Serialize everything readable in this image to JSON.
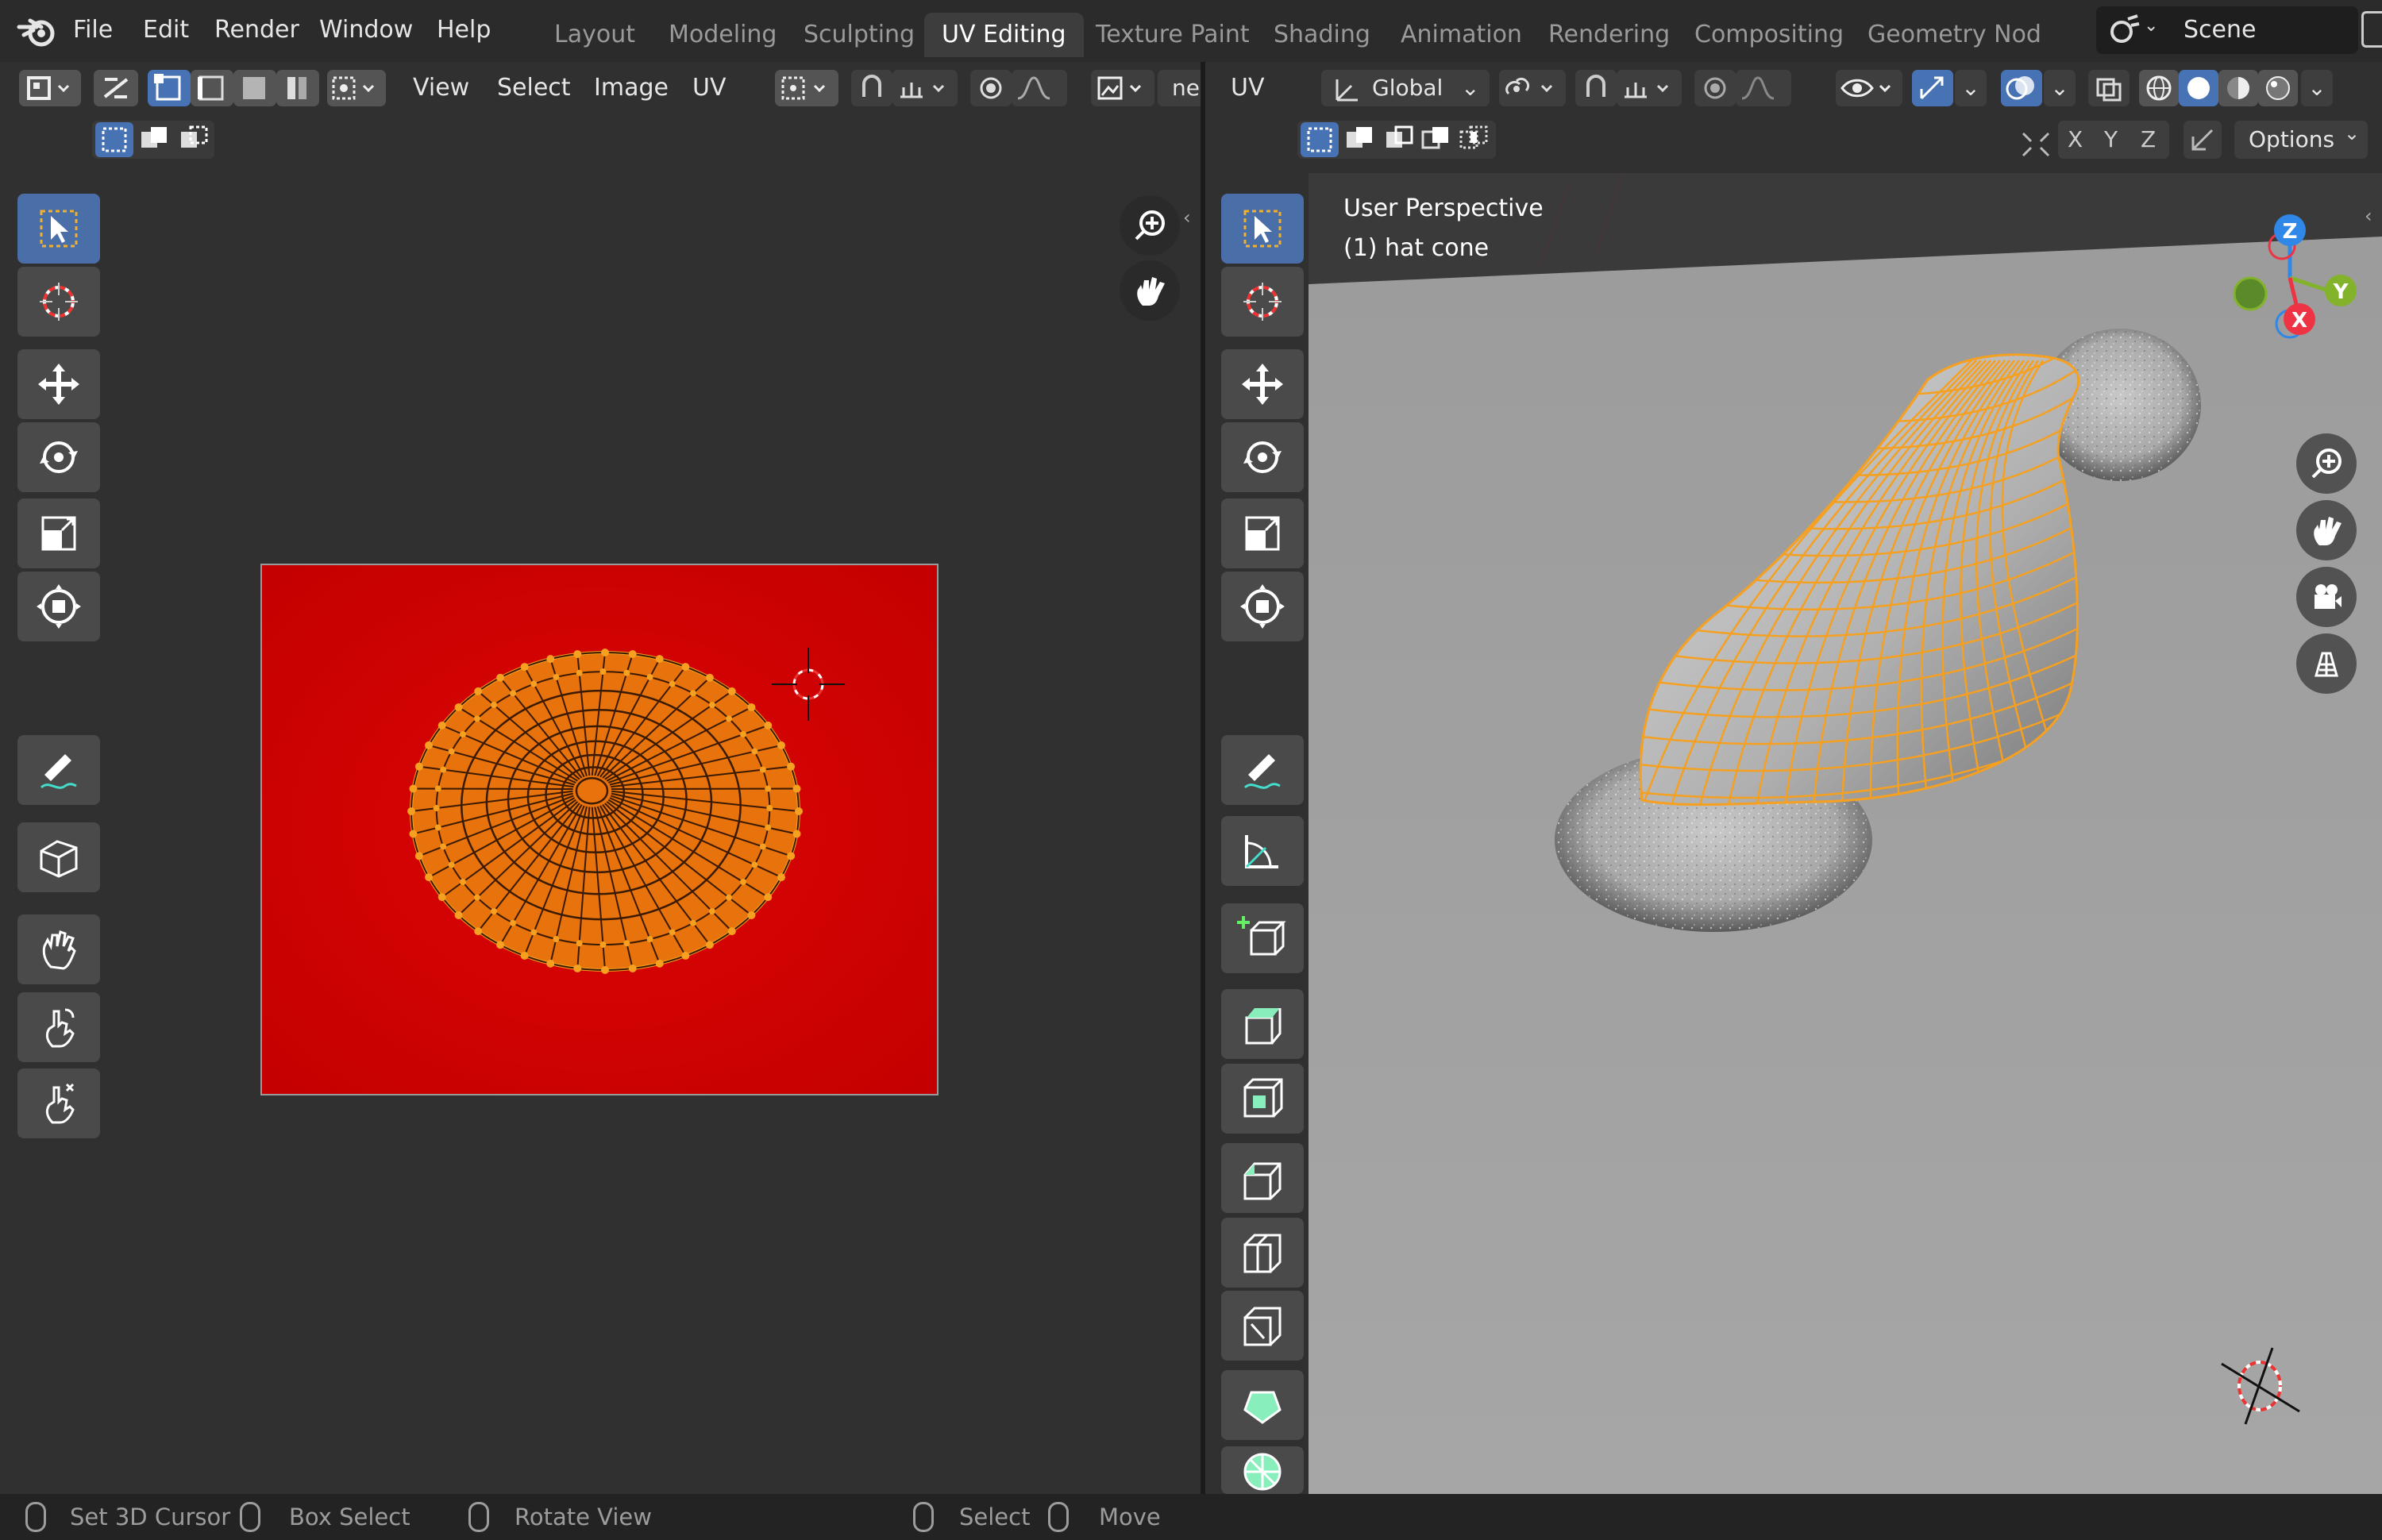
{
  "menu": [
    "File",
    "Edit",
    "Render",
    "Window",
    "Help"
  ],
  "workspaces": [
    "Layout",
    "Modeling",
    "Sculpting",
    "UV Editing",
    "Texture Paint",
    "Shading",
    "Animation",
    "Rendering",
    "Compositing",
    "Geometry Nod"
  ],
  "active_workspace": "UV Editing",
  "scene": "Scene",
  "uv_editor": {
    "header_menus": [
      "View",
      "Select",
      "Image",
      "UV"
    ],
    "image_name_truncated": "ne",
    "texture_color": "#cc0000",
    "uv_color": "#e8720c"
  },
  "viewport": {
    "header_mode": "UV",
    "transform_orientation": "Global",
    "options_label": "Options",
    "axis_labels": [
      "X",
      "Y",
      "Z"
    ],
    "overlay_title": "User Perspective",
    "overlay_object": "(1) hat cone",
    "gizmo": {
      "x": "X",
      "y": "Y",
      "z": "Z",
      "x_color": "#ee3344",
      "y_color": "#82b32b",
      "z_color": "#2f87e8"
    }
  },
  "status_bar": {
    "items": [
      "Set 3D Cursor",
      "Box Select",
      "Rotate View",
      "Select",
      "Move"
    ]
  },
  "colors": {
    "selected_tool": "#4a6ea8",
    "active_button": "#4772b3",
    "mesh_selection": "#f5a020"
  }
}
